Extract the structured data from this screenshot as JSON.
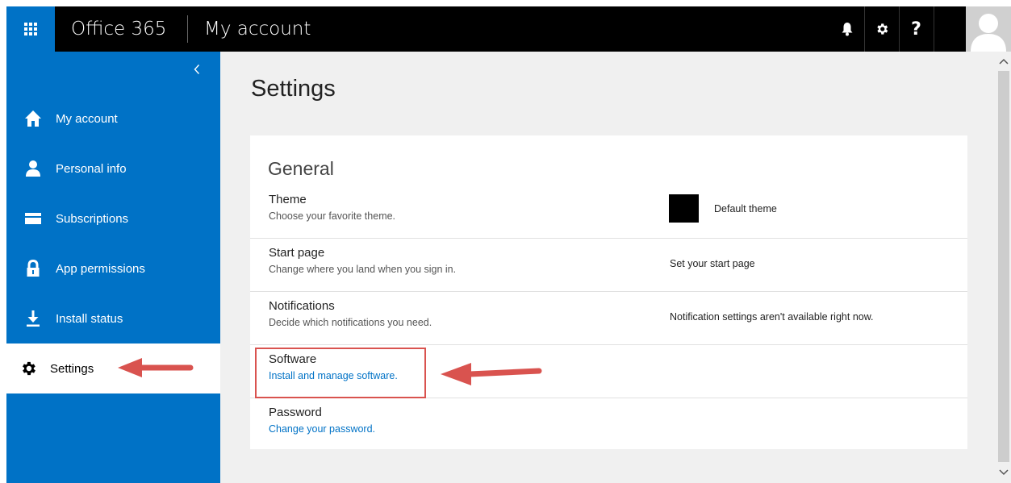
{
  "header": {
    "brand": "Office 365",
    "app_title": "My account",
    "help_label": "?",
    "icons": [
      "app-launcher-icon",
      "bell-icon",
      "gear-icon",
      "help-icon",
      "user-avatar-icon"
    ]
  },
  "sidebar": {
    "collapse_icon": "chevron-left-icon",
    "items": [
      {
        "label": "My account",
        "icon": "home-icon"
      },
      {
        "label": "Personal info",
        "icon": "person-icon"
      },
      {
        "label": "Subscriptions",
        "icon": "card-icon"
      },
      {
        "label": "App permissions",
        "icon": "lock-icon"
      },
      {
        "label": "Install status",
        "icon": "download-icon"
      },
      {
        "label": "Settings",
        "icon": "gear-icon",
        "active": true
      }
    ]
  },
  "main": {
    "page_title": "Settings",
    "section_title": "General",
    "rows": [
      {
        "label": "Theme",
        "desc": "Choose your favorite theme.",
        "value": "Default theme"
      },
      {
        "label": "Start page",
        "desc": "Change where you land when you sign in.",
        "value": "Set your start page"
      },
      {
        "label": "Notifications",
        "desc": "Decide which notifications you need.",
        "value": "Notification settings aren't available right now."
      },
      {
        "label": "Software",
        "desc": "Install and manage software.",
        "value": ""
      },
      {
        "label": "Password",
        "desc": "Change your password.",
        "value": ""
      }
    ]
  },
  "colors": {
    "brand_blue": "#0072c6",
    "top_bar": "#000000",
    "annotation_red": "#d9534f",
    "link": "#0072c6"
  }
}
